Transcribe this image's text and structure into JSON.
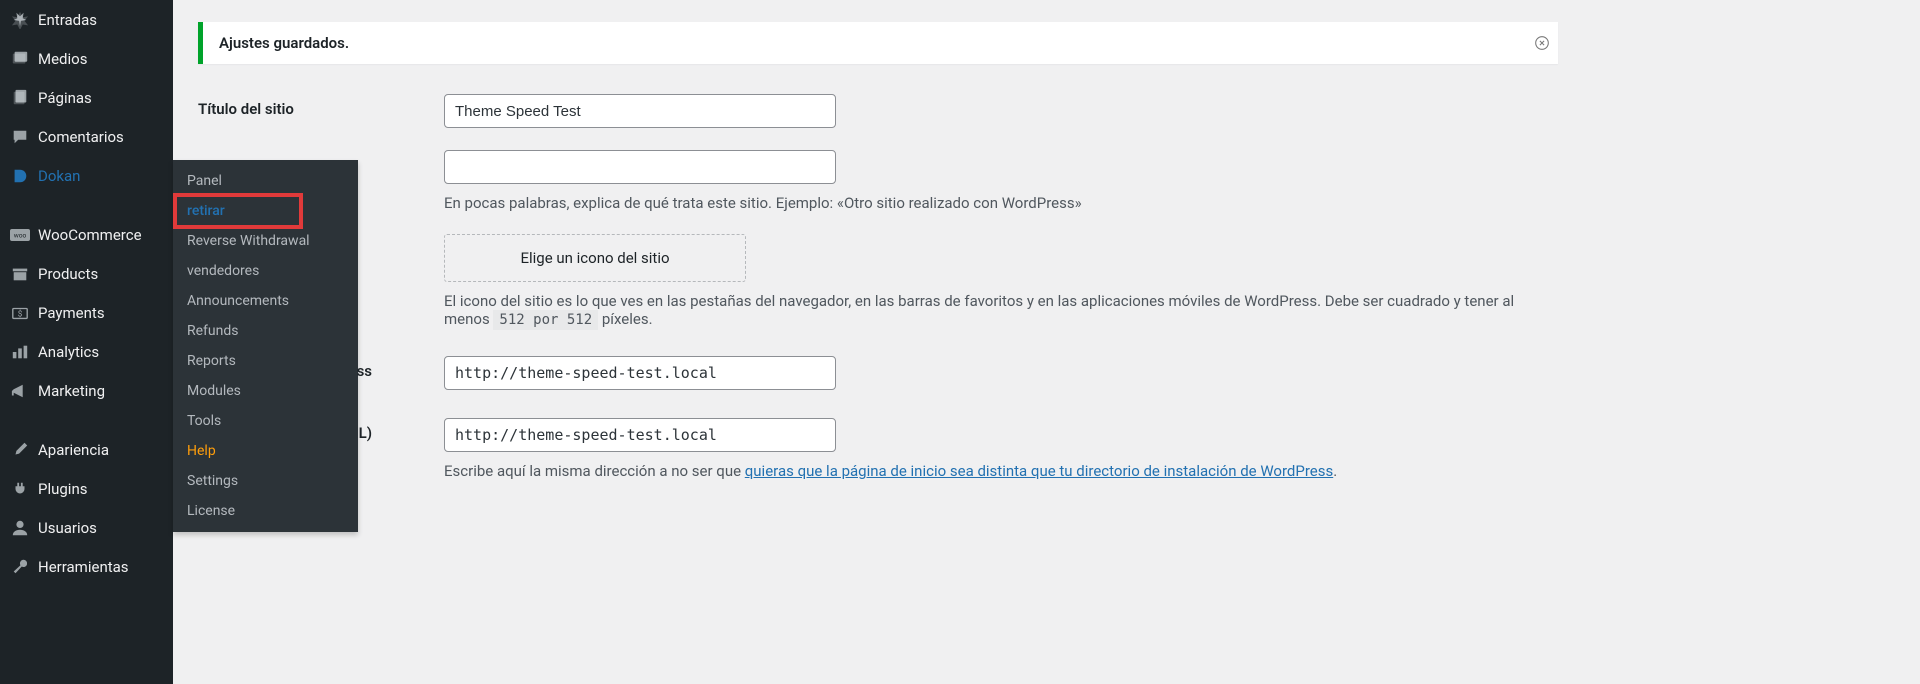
{
  "notice": {
    "text": "Ajustes guardados."
  },
  "sidebar": {
    "items": [
      {
        "label": "Entradas"
      },
      {
        "label": "Medios"
      },
      {
        "label": "Páginas"
      },
      {
        "label": "Comentarios"
      },
      {
        "label": "Dokan"
      },
      {
        "label": "WooCommerce"
      },
      {
        "label": "Products"
      },
      {
        "label": "Payments"
      },
      {
        "label": "Analytics"
      },
      {
        "label": "Marketing"
      },
      {
        "label": "Apariencia"
      },
      {
        "label": "Plugins"
      },
      {
        "label": "Usuarios"
      },
      {
        "label": "Herramientas"
      }
    ]
  },
  "submenu": {
    "items": [
      {
        "label": "Panel"
      },
      {
        "label": "retirar"
      },
      {
        "label": "Reverse Withdrawal"
      },
      {
        "label": "vendedores"
      },
      {
        "label": "Announcements"
      },
      {
        "label": "Refunds"
      },
      {
        "label": "Reports"
      },
      {
        "label": "Modules"
      },
      {
        "label": "Tools"
      },
      {
        "label": "Help"
      },
      {
        "label": "Settings"
      },
      {
        "label": "License"
      }
    ]
  },
  "form": {
    "site_title_label": "Título del sitio",
    "site_title_value": "Theme Speed Test",
    "tagline_value": "",
    "tagline_desc": "En pocas palabras, explica de qué trata este sitio. Ejemplo: «Otro sitio realizado con WordPress»",
    "choose_icon": "Elige un icono del sitio",
    "icon_desc_pre": "El icono del sitio es lo que ves en las pestañas del navegador, en las barras de favoritos y en las aplicaciones móviles de WordPress. Debe ser cuadrado y tener al menos ",
    "icon_code": "512 por 512",
    "icon_desc_post": " píxeles.",
    "wp_url_label_tail": "ss",
    "wp_url_value": "http://theme-speed-test.local",
    "site_url_label_tail": "L)",
    "site_url_value": "http://theme-speed-test.local",
    "site_url_desc_pre": "Escribe aquí la misma dirección a no ser que ",
    "site_url_link": "quieras que la página de inicio sea distinta que tu directorio de instalación de WordPress",
    "site_url_desc_post": "."
  }
}
